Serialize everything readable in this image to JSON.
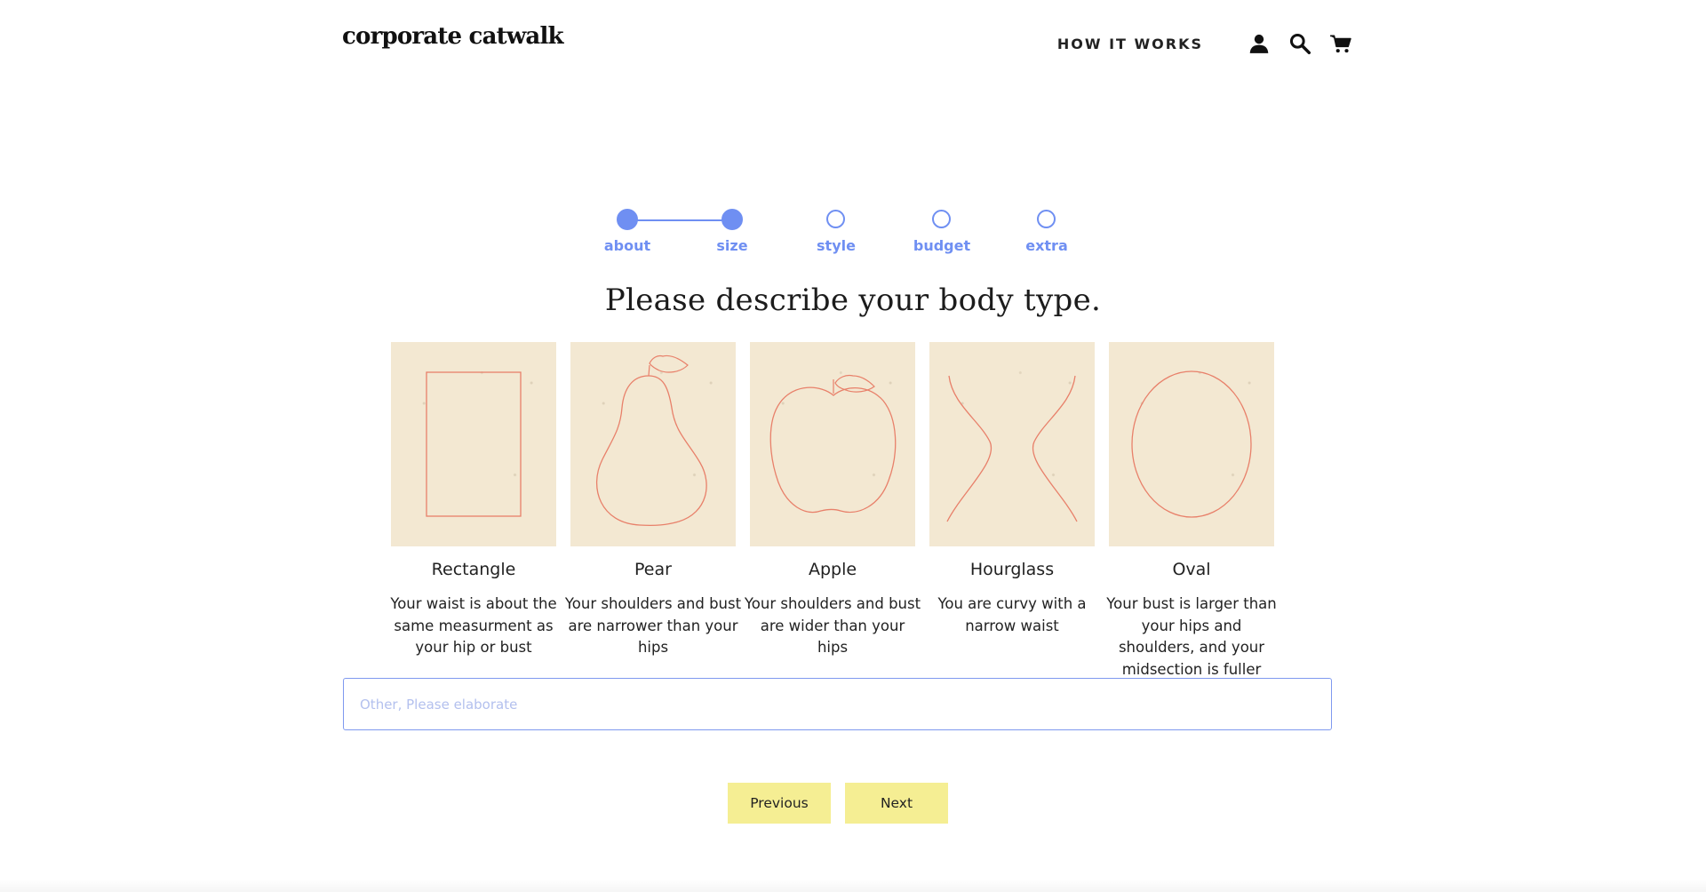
{
  "brand": {
    "name": "corporate catwalk"
  },
  "nav": {
    "how_it_works": "HOW IT WORKS",
    "icons": [
      "account-icon",
      "search-icon",
      "cart-icon"
    ]
  },
  "stepper": {
    "steps": [
      {
        "label": "about",
        "completed": true
      },
      {
        "label": "size",
        "completed": true
      },
      {
        "label": "style",
        "completed": false
      },
      {
        "label": "budget",
        "completed": false
      },
      {
        "label": "extra",
        "completed": false
      }
    ],
    "accent_color": "#6f8ff2"
  },
  "question": {
    "title": "Please describe your body type."
  },
  "body_types": [
    {
      "name": "Rectangle",
      "description": "Your waist is about the same measurment as your hip or bust",
      "icon": "rectangle-shape-icon"
    },
    {
      "name": "Pear",
      "description": "Your shoulders and bust are narrower than your hips",
      "icon": "pear-shape-icon"
    },
    {
      "name": "Apple",
      "description": "Your shoulders and bust are wider than your hips",
      "icon": "apple-shape-icon"
    },
    {
      "name": "Hourglass",
      "description": "You are curvy with a narrow waist",
      "icon": "hourglass-shape-icon"
    },
    {
      "name": "Oval",
      "description": "Your bust is larger than your hips and shoulders, and your midsection is fuller",
      "icon": "oval-shape-icon"
    }
  ],
  "other": {
    "placeholder": "Other, Please elaborate",
    "value": ""
  },
  "buttons": {
    "previous": "Previous",
    "next": "Next",
    "color": "#f5ee93"
  },
  "colors": {
    "card_background": "#f3e8d2",
    "illustration_stroke": "#e8806a"
  }
}
